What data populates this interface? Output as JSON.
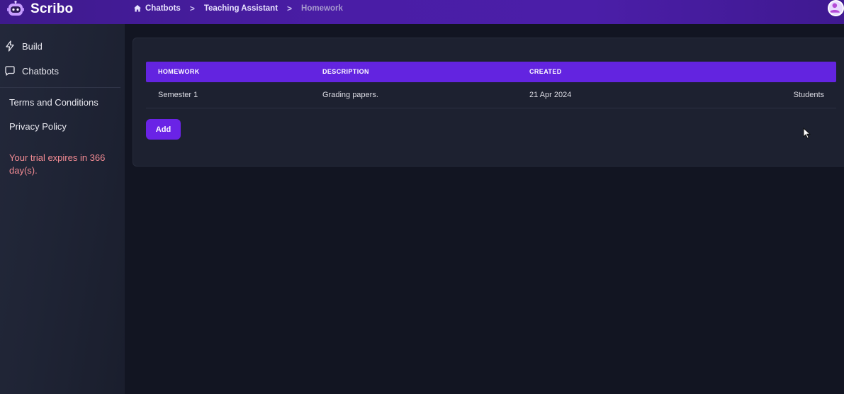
{
  "app": {
    "name": "Scribo"
  },
  "breadcrumb": {
    "items": [
      "Chatbots",
      "Teaching Assistant",
      "Homework"
    ],
    "separator": ">"
  },
  "sidebar": {
    "nav": [
      {
        "label": "Build",
        "icon": "bolt-icon"
      },
      {
        "label": "Chatbots",
        "icon": "chat-bubble-icon"
      }
    ],
    "links": [
      "Terms and Conditions",
      "Privacy Policy"
    ],
    "trial_notice": "Your trial expires in 366 day(s)."
  },
  "table": {
    "columns": [
      "HOMEWORK",
      "DESCRIPTION",
      "CREATED"
    ],
    "rows": [
      {
        "homework": "Semester 1",
        "description": "Grading papers.",
        "created": "21 Apr 2024",
        "action": "Students"
      }
    ]
  },
  "actions": {
    "add_label": "Add"
  },
  "colors": {
    "accent": "#6324e0",
    "topbar": "#4a1da6",
    "trial_text": "#f28b93",
    "background": "#121522"
  }
}
